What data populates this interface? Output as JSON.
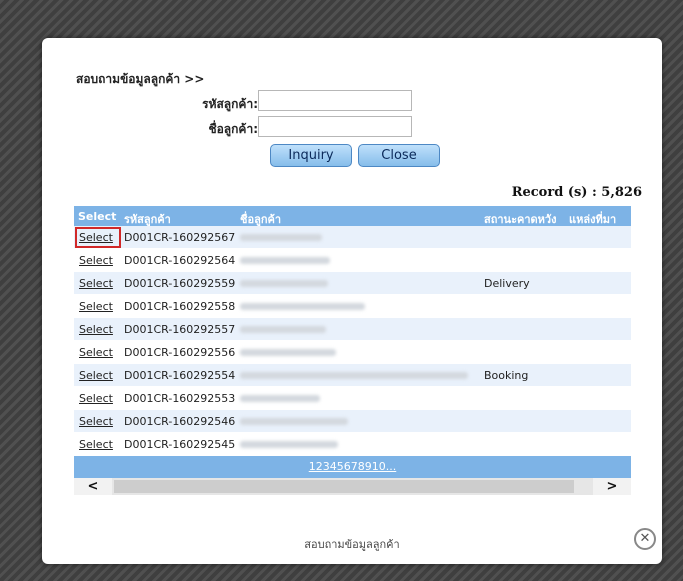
{
  "form": {
    "title": "สอบถามข้อมูลลูกค้า >>",
    "customer_code_label": "รหัสลูกค้า:",
    "customer_name_label": "ชื่อลูกค้า:",
    "customer_code_value": "",
    "customer_name_value": "",
    "inquiry_label": "Inquiry",
    "close_label": "Close"
  },
  "record_count": "Record (s) : 5,826",
  "grid": {
    "headers": {
      "select": "Select",
      "code": "รหัสลูกค้า",
      "name": "ชื่อลูกค้า",
      "status": "สถานะคาดหวัง",
      "source": "แหล่งที่มา"
    },
    "rows": [
      {
        "select": "Select",
        "code": "D001CR-160292567",
        "status": ""
      },
      {
        "select": "Select",
        "code": "D001CR-160292564",
        "status": ""
      },
      {
        "select": "Select",
        "code": "D001CR-160292559",
        "status": "Delivery"
      },
      {
        "select": "Select",
        "code": "D001CR-160292558",
        "status": ""
      },
      {
        "select": "Select",
        "code": "D001CR-160292557",
        "status": ""
      },
      {
        "select": "Select",
        "code": "D001CR-160292556",
        "status": ""
      },
      {
        "select": "Select",
        "code": "D001CR-160292554",
        "status": "Booking"
      },
      {
        "select": "Select",
        "code": "D001CR-160292553",
        "status": ""
      },
      {
        "select": "Select",
        "code": "D001CR-160292546",
        "status": ""
      },
      {
        "select": "Select",
        "code": "D001CR-160292545",
        "status": ""
      }
    ],
    "pager": "12345678910..."
  },
  "footer": {
    "title": "สอบถามข้อมูลลูกค้า",
    "close_symbol": "✕"
  },
  "scroll": {
    "left": "<",
    "right": ">"
  },
  "colors": {
    "header_bg": "#7db3e6",
    "highlight": "#d12828",
    "button": "#86bdea"
  }
}
